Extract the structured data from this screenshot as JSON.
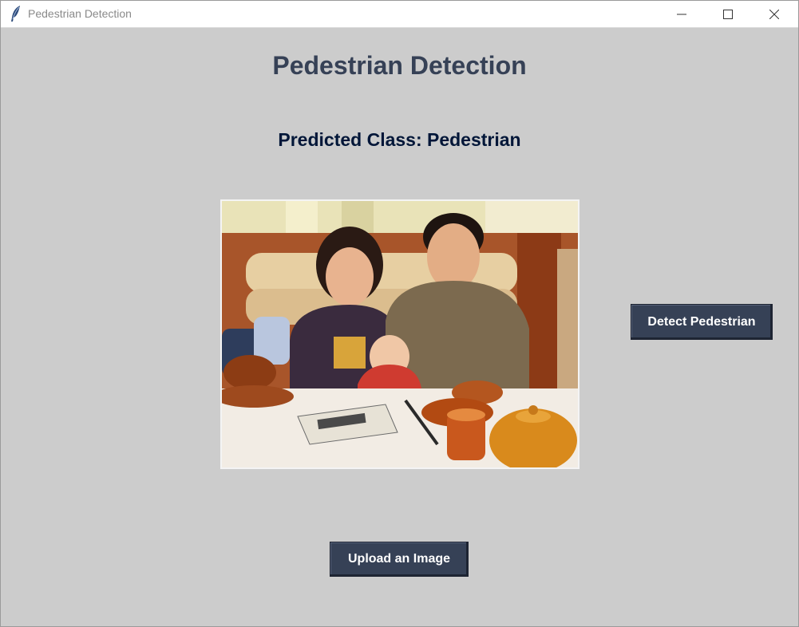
{
  "window": {
    "title": "Pedestrian Detection",
    "app_icon": "feather-icon",
    "controls": [
      "minimize-icon",
      "maximize-icon",
      "close-icon"
    ]
  },
  "main": {
    "heading": "Pedestrian Detection",
    "prediction_text": "Predicted Class: Pedestrian",
    "photo_alt": "family-photo",
    "detect_button_label": "Detect Pedestrian",
    "upload_button_label": "Upload an Image"
  },
  "colors": {
    "background": "#cccccc",
    "heading": "#364156",
    "prediction": "#011638",
    "button_bg": "#364156",
    "button_text": "#ffffff"
  }
}
